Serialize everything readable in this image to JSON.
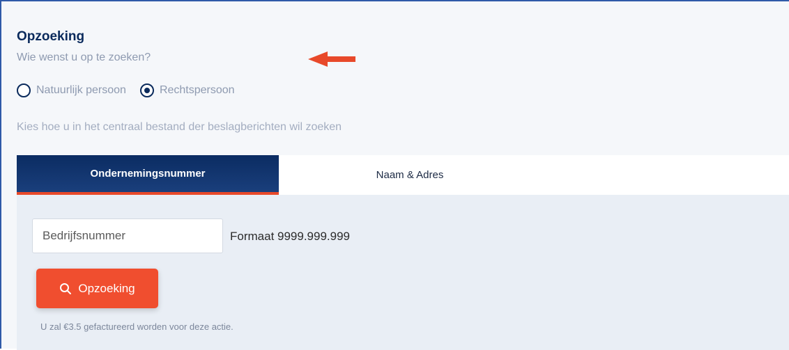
{
  "header": {
    "title": "Opzoeking",
    "subtitle": "Wie wenst u op te zoeken?"
  },
  "person_type": {
    "options": [
      {
        "label": "Natuurlijk persoon",
        "selected": false
      },
      {
        "label": "Rechtspersoon",
        "selected": true
      }
    ]
  },
  "hint": "Kies hoe u in het centraal bestand der beslagberichten wil zoeken",
  "tabs": [
    {
      "label": "Ondernemingsnummer",
      "active": true
    },
    {
      "label": "Naam & Adres",
      "active": false
    }
  ],
  "search": {
    "placeholder": "Bedrijfsnummer",
    "value": "",
    "format_hint": "Formaat 9999.999.999",
    "button_label": "Opzoeking",
    "button_icon": "search-icon",
    "billing_note": "U zal €3.5 gefactureerd worden voor deze actie."
  },
  "colors": {
    "accent": "#f04e2f",
    "primary": "#0a2a5c",
    "arrow": "#e8492a"
  }
}
